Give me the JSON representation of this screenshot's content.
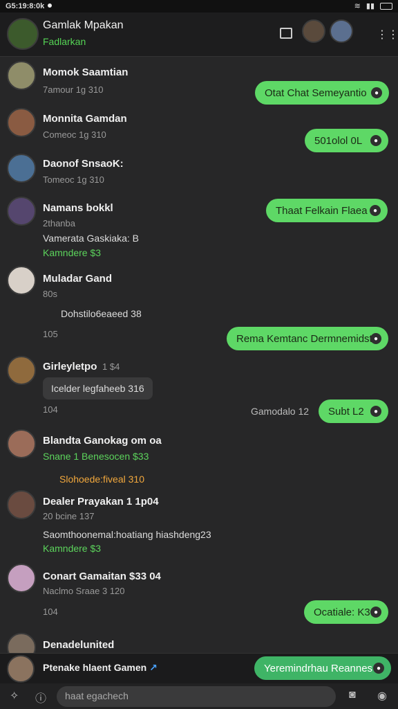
{
  "status": {
    "time": "G5:19:8:0k",
    "icons": [
      "wifi-icon",
      "signal-icon",
      "battery-icon"
    ]
  },
  "header": {
    "title": "Gamlak Mpakan",
    "subtitle": "Fadlarkan"
  },
  "conversations": [
    {
      "name": "Momok Saamtian",
      "meta": "7amour 1g 310"
    },
    {
      "name": "Monnita Gamdan",
      "meta": "Comeoc 1g 310"
    },
    {
      "name": "Daonof SnsaoK:",
      "meta": "Tomeoc 1g 310"
    },
    {
      "name": "Namans bokkl",
      "meta": "2thanba",
      "line1": "Vamerata Gaskiaka: B",
      "line2": "Kamndere $3 "
    },
    {
      "name": "Muladar Gand",
      "meta": "80s",
      "line1": "Dohstilo6eaeed 38",
      "line2": "105"
    },
    {
      "name": "Girleyletpo",
      "meta": "1 $4",
      "pill": "Icelder legfaheeb 316",
      "meta2": "104"
    },
    {
      "name": "Blandta Ganokag om oa",
      "meta": "Snane 1 Benesocen $33",
      "line1": "Slohoede:fiveal 310"
    },
    {
      "name": "Dealer Prayakan 1 1p04",
      "meta": "20 bcine 137",
      "line1": "Saomthoonemal:hoatiang hiashdeng23",
      "line2": "Kamndere $3"
    },
    {
      "name": "Conart Gamaitan $33 04",
      "meta": "Naclmo Sraae 3 120",
      "meta2": "104"
    },
    {
      "name": "Denadelunited"
    }
  ],
  "bubbles": [
    {
      "text": "Otat Chat Semeyantio"
    },
    {
      "text": "501olol 0L"
    },
    {
      "text": "Thaat Felkain Flaea"
    },
    {
      "text": "Rema Kemtanc Dermnemidst"
    },
    {
      "text": "Subt L2"
    },
    {
      "text": "Ocatiale: K3"
    },
    {
      "text": "Yeremindrhau Reannes"
    }
  ],
  "side_labels": {
    "gamodalo": "Gamodalo 12"
  },
  "footer_preview": {
    "name": "Ptenake hlaent Gamen",
    "arrow": "↗"
  },
  "composer": {
    "placeholder": "haat egachech"
  },
  "colors": {
    "accent": "#5ed866",
    "bg": "#272728",
    "header": "#1d1d1e"
  }
}
